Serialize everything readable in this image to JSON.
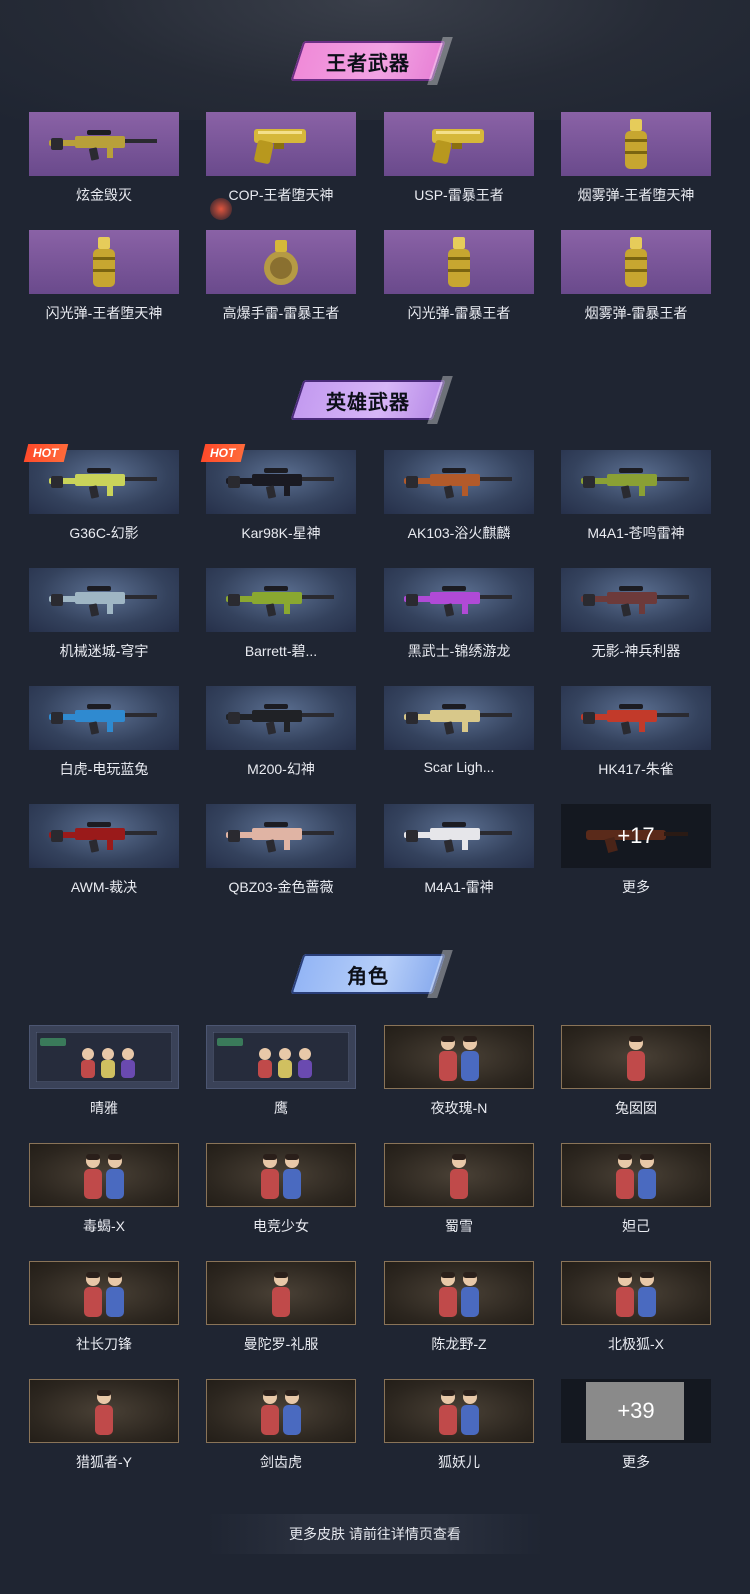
{
  "sections": {
    "king": {
      "title": "王者武器",
      "items": [
        {
          "label": "炫金毁灭",
          "icon": "sniper-rifle-gold-icon"
        },
        {
          "label": "COP-王者堕天神",
          "icon": "pistol-gold-icon"
        },
        {
          "label": "USP-雷暴王者",
          "icon": "pistol-gold-icon"
        },
        {
          "label": "烟雾弹-王者堕天神",
          "icon": "smoke-grenade-gold-icon"
        },
        {
          "label": "闪光弹-王者堕天神",
          "icon": "flash-grenade-gold-icon"
        },
        {
          "label": "高爆手雷-雷暴王者",
          "icon": "grenade-gold-icon"
        },
        {
          "label": "闪光弹-雷暴王者",
          "icon": "flash-grenade-gold-icon"
        },
        {
          "label": "烟雾弹-雷暴王者",
          "icon": "smoke-grenade-gold-icon"
        }
      ]
    },
    "hero": {
      "title": "英雄武器",
      "hot_label": "HOT",
      "items": [
        {
          "label": "G36C-幻影",
          "hot": true,
          "color": "#c9d35a"
        },
        {
          "label": "Kar98K-星神",
          "hot": true,
          "color": "#1a1a22"
        },
        {
          "label": "AK103-浴火麒麟",
          "hot": false,
          "color": "#b25a2a"
        },
        {
          "label": "M4A1-苍鸣雷神",
          "hot": false,
          "color": "#8aa034"
        },
        {
          "label": "机械迷城-穹宇",
          "hot": false,
          "color": "#9fb6c4"
        },
        {
          "label": "Barrett-碧...",
          "hot": false,
          "color": "#8aa830"
        },
        {
          "label": "黑武士-锦绣游龙",
          "hot": false,
          "color": "#b04ad6"
        },
        {
          "label": "无影-神兵利器",
          "hot": false,
          "color": "#6d3a3a"
        },
        {
          "label": "白虎-电玩蓝兔",
          "hot": false,
          "color": "#2f8ad0"
        },
        {
          "label": "M200-幻神",
          "hot": false,
          "color": "#202226"
        },
        {
          "label": "Scar Ligh...",
          "hot": false,
          "color": "#d8c88a"
        },
        {
          "label": "HK417-朱雀",
          "hot": false,
          "color": "#c23a2a"
        },
        {
          "label": "AWM-裁决",
          "hot": false,
          "color": "#9a1a1a"
        },
        {
          "label": "QBZ03-金色蔷薇",
          "hot": false,
          "color": "#e0b4a4"
        },
        {
          "label": "M4A1-雷神",
          "hot": false,
          "color": "#e6e6ea"
        }
      ],
      "more": {
        "label": "更多",
        "count": "+17"
      }
    },
    "char": {
      "title": "角色",
      "items": [
        {
          "label": "晴雅",
          "style": "screen"
        },
        {
          "label": "鹰",
          "style": "screen"
        },
        {
          "label": "夜玫瑰-N",
          "style": "card"
        },
        {
          "label": "兔囡囡",
          "style": "card"
        },
        {
          "label": "毒蝎-X",
          "style": "card"
        },
        {
          "label": "电竞少女",
          "style": "card"
        },
        {
          "label": "蜀雪",
          "style": "card"
        },
        {
          "label": "妲己",
          "style": "card"
        },
        {
          "label": "社长刀锋",
          "style": "card"
        },
        {
          "label": "曼陀罗-礼服",
          "style": "card"
        },
        {
          "label": "陈龙野-Z",
          "style": "card"
        },
        {
          "label": "北极狐-X",
          "style": "card"
        },
        {
          "label": "猎狐者-Y",
          "style": "card"
        },
        {
          "label": "剑齿虎",
          "style": "card"
        },
        {
          "label": "狐妖儿",
          "style": "card"
        }
      ],
      "more": {
        "label": "更多",
        "count": "+39"
      }
    }
  },
  "footer": {
    "text": "更多皮肤 请前往详情页查看"
  }
}
